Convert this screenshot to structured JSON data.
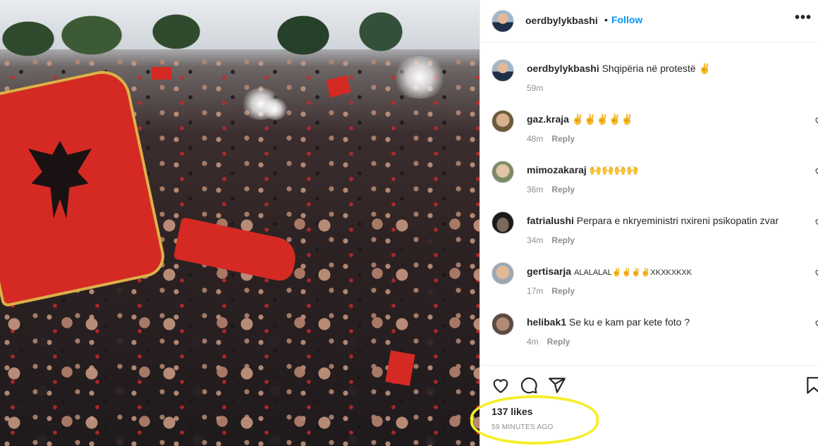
{
  "post": {
    "author": "oerdbylykbashi",
    "follow_label": "Follow",
    "dot": "•",
    "more_icon": "more-horizontal-icon",
    "more_label": "•••",
    "caption": "Shqipëria në protestë ✌",
    "caption_time": "59m"
  },
  "comments": [
    {
      "user": "gaz.kraja",
      "text": "✌✌✌✌✌",
      "time": "48m",
      "reply": "Reply"
    },
    {
      "user": "mimozakaraj",
      "text": "🙌🙌🙌🙌",
      "time": "36m",
      "reply": "Reply"
    },
    {
      "user": "fatrialushi",
      "text": "Perpara e nkryeministri nxireni psikopatin zvar",
      "time": "34m",
      "reply": "Reply"
    },
    {
      "user": "gertisarja",
      "text": "ALALALAL✌✌✌✌XKXKXKXK",
      "time": "17m",
      "reply": "Reply"
    },
    {
      "user": "helibak1",
      "text": "Se ku e kam par kete foto ?",
      "time": "4m",
      "reply": "Reply"
    }
  ],
  "footer": {
    "likes": "137 likes",
    "time_ago": "59 MINUTES AGO",
    "icons": [
      "heart-icon",
      "comment-icon",
      "share-icon",
      "bookmark-icon"
    ]
  },
  "colors": {
    "follow": "#0095f6",
    "highlight": "#f4ef2a",
    "muted": "#8e8e8e"
  }
}
